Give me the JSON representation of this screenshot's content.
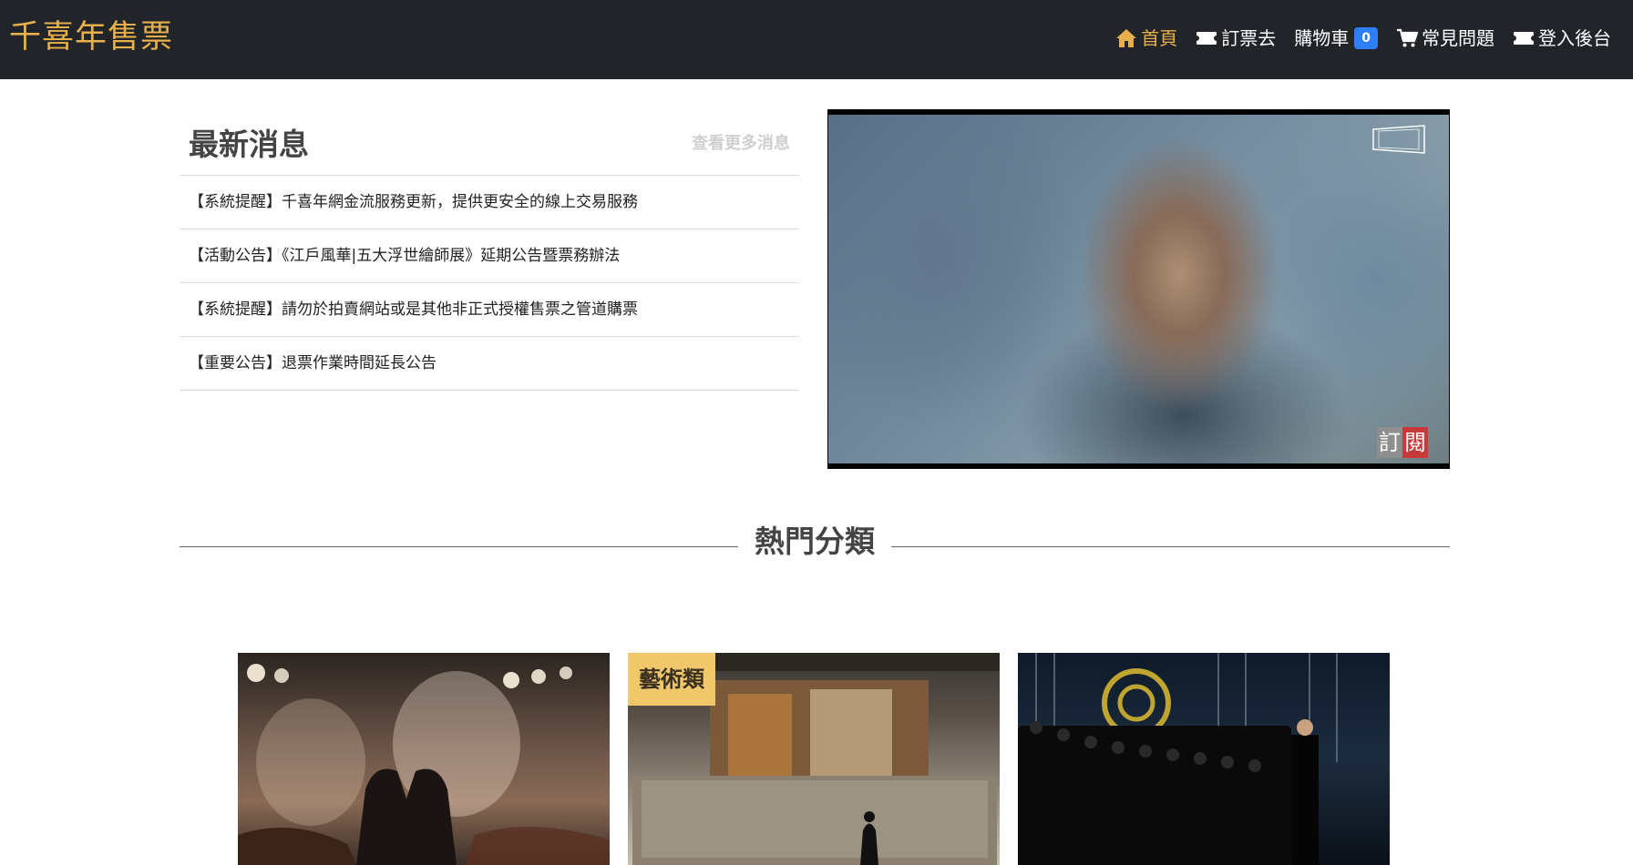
{
  "nav": {
    "brand": "千喜年售票",
    "items": [
      {
        "label": "首頁",
        "icon": "home-icon",
        "active": true
      },
      {
        "label": "訂票去",
        "icon": "ticket-icon",
        "active": false
      },
      {
        "label": "購物車",
        "icon": "",
        "badge": "0",
        "active": false
      },
      {
        "label": "常見問題",
        "icon": "cart-icon",
        "active": false
      },
      {
        "label": "登入後台",
        "icon": "ticket-icon",
        "active": false
      }
    ]
  },
  "news": {
    "title": "最新消息",
    "more_label": "查看更多消息",
    "items": [
      "【系統提醒】千喜年網金流服務更新，提供更安全的線上交易服務",
      "【活動公告】《江戶風華|五大浮世繪師展》延期公告暨票務辦法",
      "【系統提醒】請勿於拍賣網站或是其他非正式授權售票之管道購票",
      "【重要公告】退票作業時間延長公告"
    ]
  },
  "video": {
    "subscribe_label": "訂閱"
  },
  "categories": {
    "title": "熱門分類",
    "cards": [
      {
        "tag": ""
      },
      {
        "tag": "藝術類"
      },
      {
        "tag": ""
      }
    ]
  },
  "colors": {
    "navbar_bg": "#212529",
    "brand": "#e8b04a",
    "badge": "#2d7ff9",
    "tag_bg": "#f0c76a"
  }
}
